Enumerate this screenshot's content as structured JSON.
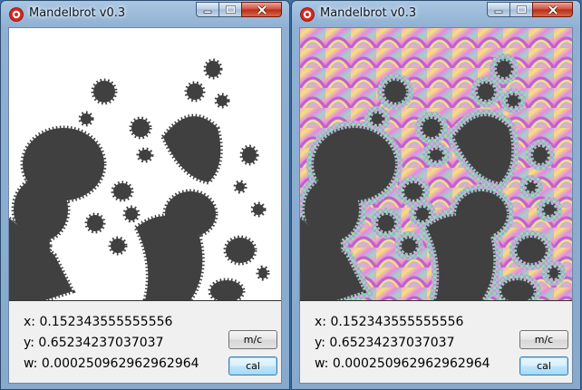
{
  "windows": [
    {
      "title": "Mandelbrot v0.3",
      "render": "monochrome",
      "info": {
        "x": "x: 0.152343555555556",
        "y": "y: 0.65234237037037",
        "w": "w: 0.000250962962962964"
      },
      "buttons": {
        "mc": "m/c",
        "cal": "cal"
      }
    },
    {
      "title": "Mandelbrot v0.3",
      "render": "colored",
      "info": {
        "x": "x: 0.152343555555556",
        "y": "y: 0.65234237037037",
        "w": "w: 0.000250962962962964"
      },
      "buttons": {
        "mc": "m/c",
        "cal": "cal"
      }
    }
  ],
  "colors": {
    "set": "#404040",
    "background_mono": "#ffffff",
    "close_button": "#c9412d",
    "title_bar": "#a9c6e2"
  },
  "icons": [
    "app-icon",
    "minimize-icon",
    "maximize-icon",
    "close-icon"
  ]
}
